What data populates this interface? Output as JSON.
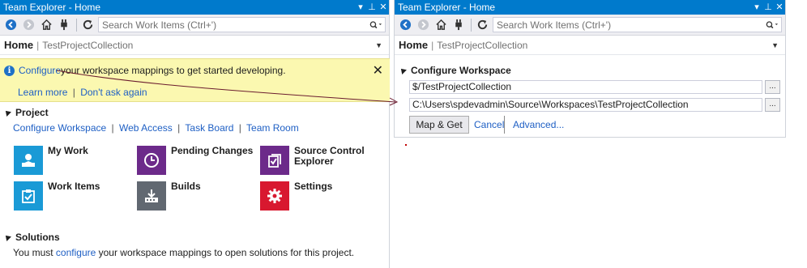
{
  "left": {
    "title": "Team Explorer - Home",
    "title_buttons": [
      "▾",
      "ᵖ",
      "✕"
    ],
    "search_placeholder": "Search Work Items (Ctrl+')",
    "home_label": "Home",
    "collection": "TestProjectCollection",
    "info": {
      "link_configure": "Configure",
      "text": " your workspace mappings to get started developing.",
      "learn_more": "Learn more",
      "dont_ask": "Don't ask again"
    },
    "project": {
      "heading": "Project",
      "links": [
        "Configure Workspace",
        "Web Access",
        "Task Board",
        "Team Room"
      ],
      "tiles": [
        {
          "label": "My Work",
          "color": "#1a9ad6"
        },
        {
          "label": "Pending Changes",
          "color": "#6c2a8a"
        },
        {
          "label": "Source Control Explorer",
          "color": "#6c2a8a"
        },
        {
          "label": "Work Items",
          "color": "#1a9ad6"
        },
        {
          "label": "Builds",
          "color": "#616871"
        },
        {
          "label": "Settings",
          "color": "#d8182f"
        }
      ]
    },
    "solutions": {
      "heading": "Solutions",
      "pre": "You must ",
      "link": "configure",
      "post": " your workspace mappings to open solutions for this project."
    }
  },
  "right": {
    "title": "Team Explorer - Home",
    "search_placeholder": "Search Work Items (Ctrl+')",
    "home_label": "Home",
    "collection": "TestProjectCollection",
    "section_heading": "Configure Workspace",
    "server_path": "$/TestProjectCollection",
    "local_path": "C:\\Users\\spdevadmin\\Source\\Workspaces\\TestProjectCollection",
    "browse_label": "...",
    "map_get": "Map & Get",
    "cancel": "Cancel",
    "advanced": "Advanced..."
  },
  "colors": {
    "accent": "#007acc",
    "link": "#1e5fc4",
    "info_bg": "#fbf8b0"
  }
}
